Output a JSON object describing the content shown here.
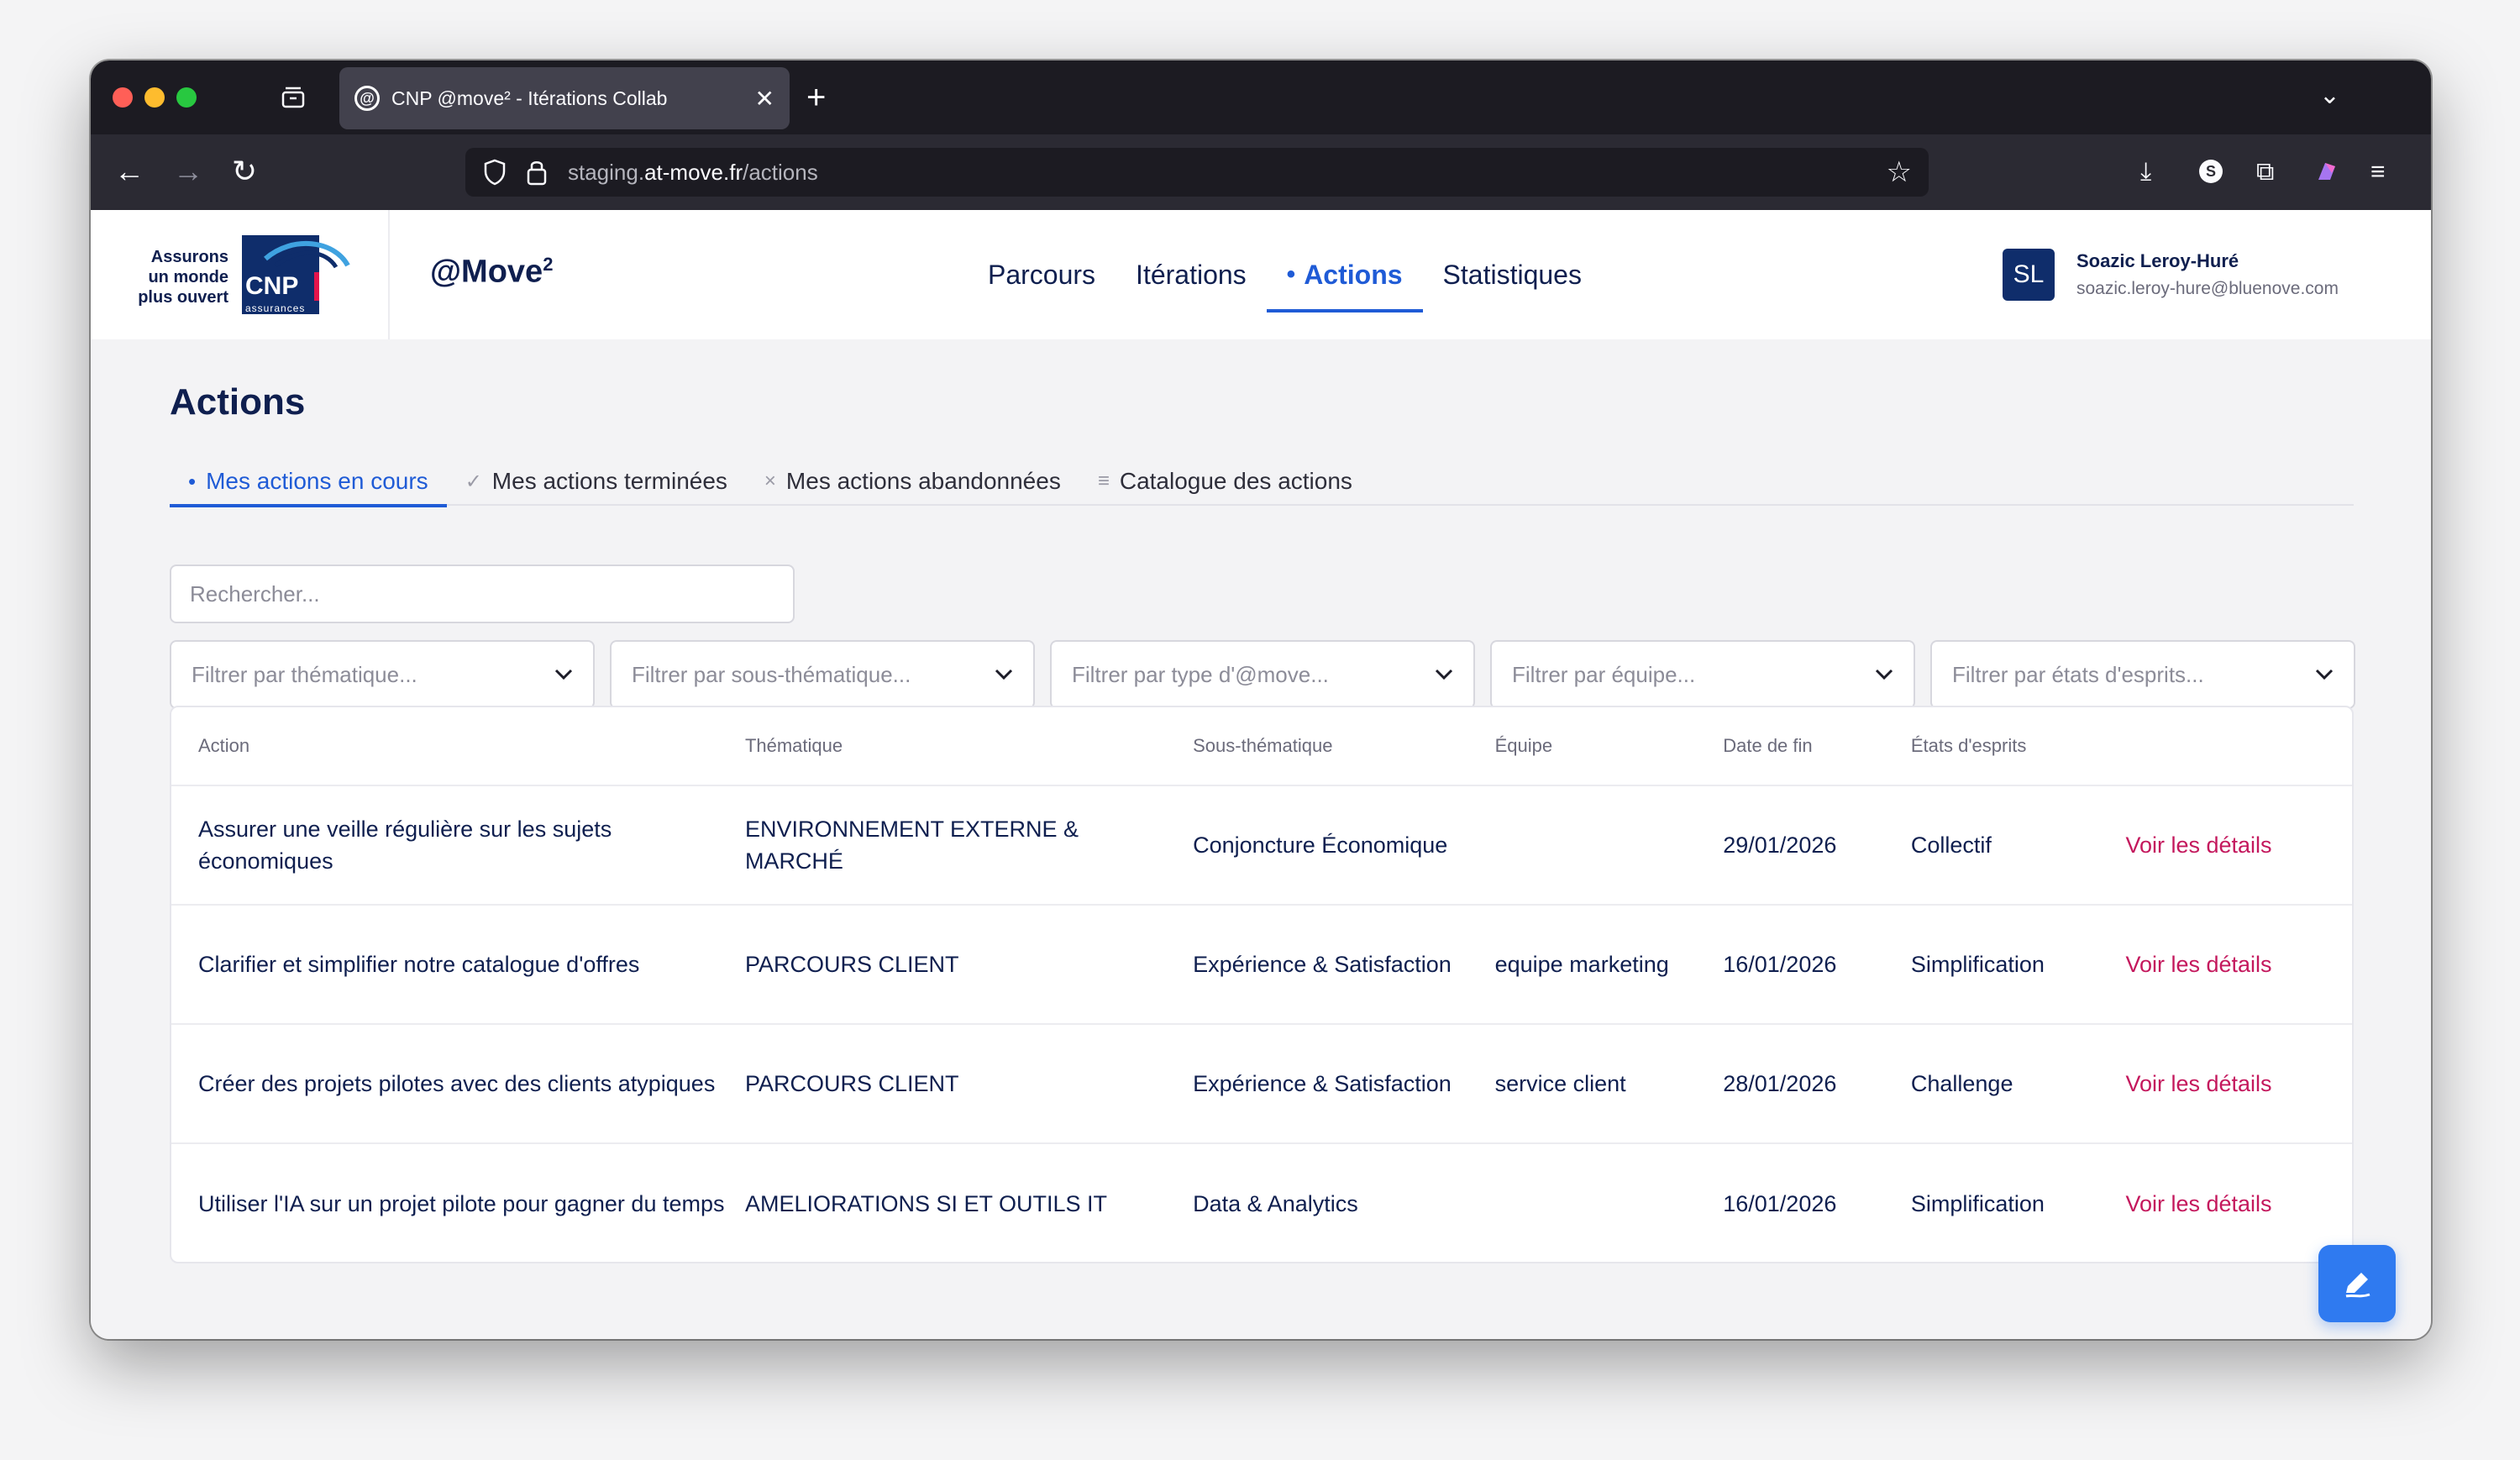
{
  "browser": {
    "tab_title": "CNP @move² - Itérations Collab",
    "tab_favicon": "@",
    "url_subdomain": "staging.",
    "url_host": "at-move.fr",
    "url_path": "/actions"
  },
  "header": {
    "logo_line1": "Assurons",
    "logo_line2": "un monde",
    "logo_line3": "plus ouvert",
    "logo_cnp": "CNP",
    "logo_assurances": "assurances",
    "brand": "@Move",
    "brand_sup": "2",
    "nav": [
      {
        "label": "Parcours"
      },
      {
        "label": "Itérations"
      },
      {
        "label": "Actions"
      },
      {
        "label": "Statistiques"
      }
    ],
    "user": {
      "initials": "SL",
      "name": "Soazic Leroy-Huré",
      "email": "soazic.leroy-hure@bluenove.com"
    }
  },
  "page": {
    "title": "Actions",
    "tabs": [
      {
        "label": "Mes actions en cours"
      },
      {
        "label": "Mes actions terminées"
      },
      {
        "label": "Mes actions abandonnées"
      },
      {
        "label": "Catalogue des actions"
      }
    ],
    "search_placeholder": "Rechercher...",
    "filters": [
      "Filtrer par thématique...",
      "Filtrer par sous-thématique...",
      "Filtrer par type d'@move...",
      "Filtrer par équipe...",
      "Filtrer par états d'esprits..."
    ]
  },
  "table": {
    "headers": [
      "Action",
      "Thématique",
      "Sous-thématique",
      "Équipe",
      "Date de fin",
      "États d'esprits"
    ],
    "rows": [
      {
        "action": "Assurer une veille régulière sur les sujets économiques",
        "thematique": "ENVIRONNEMENT EXTERNE & MARCHÉ",
        "sous_thematique": "Conjoncture Économique",
        "equipe": "",
        "date": "29/01/2026",
        "etat": "Collectif",
        "link": "Voir les détails"
      },
      {
        "action": "Clarifier et simplifier notre catalogue d'offres",
        "thematique": "PARCOURS CLIENT",
        "sous_thematique": "Expérience & Satisfaction",
        "equipe": "equipe marketing",
        "date": "16/01/2026",
        "etat": "Simplification",
        "link": "Voir les détails"
      },
      {
        "action": "Créer des projets pilotes avec des clients atypiques",
        "thematique": "PARCOURS CLIENT",
        "sous_thematique": "Expérience & Satisfaction",
        "equipe": "service client",
        "date": "28/01/2026",
        "etat": "Challenge",
        "link": "Voir les détails"
      },
      {
        "action": "Utiliser l'IA sur un projet pilote pour gagner du temps",
        "thematique": "AMELIORATIONS SI ET OUTILS IT",
        "sous_thematique": "Data & Analytics",
        "equipe": "",
        "date": "16/01/2026",
        "etat": "Simplification",
        "link": "Voir les détails"
      }
    ]
  },
  "colors": {
    "accent": "#1f5bd6",
    "navy": "#0f1f4f",
    "link": "#c4185d",
    "fab": "#2f7af0"
  },
  "icons": {
    "fab": "edit-pen-icon"
  }
}
